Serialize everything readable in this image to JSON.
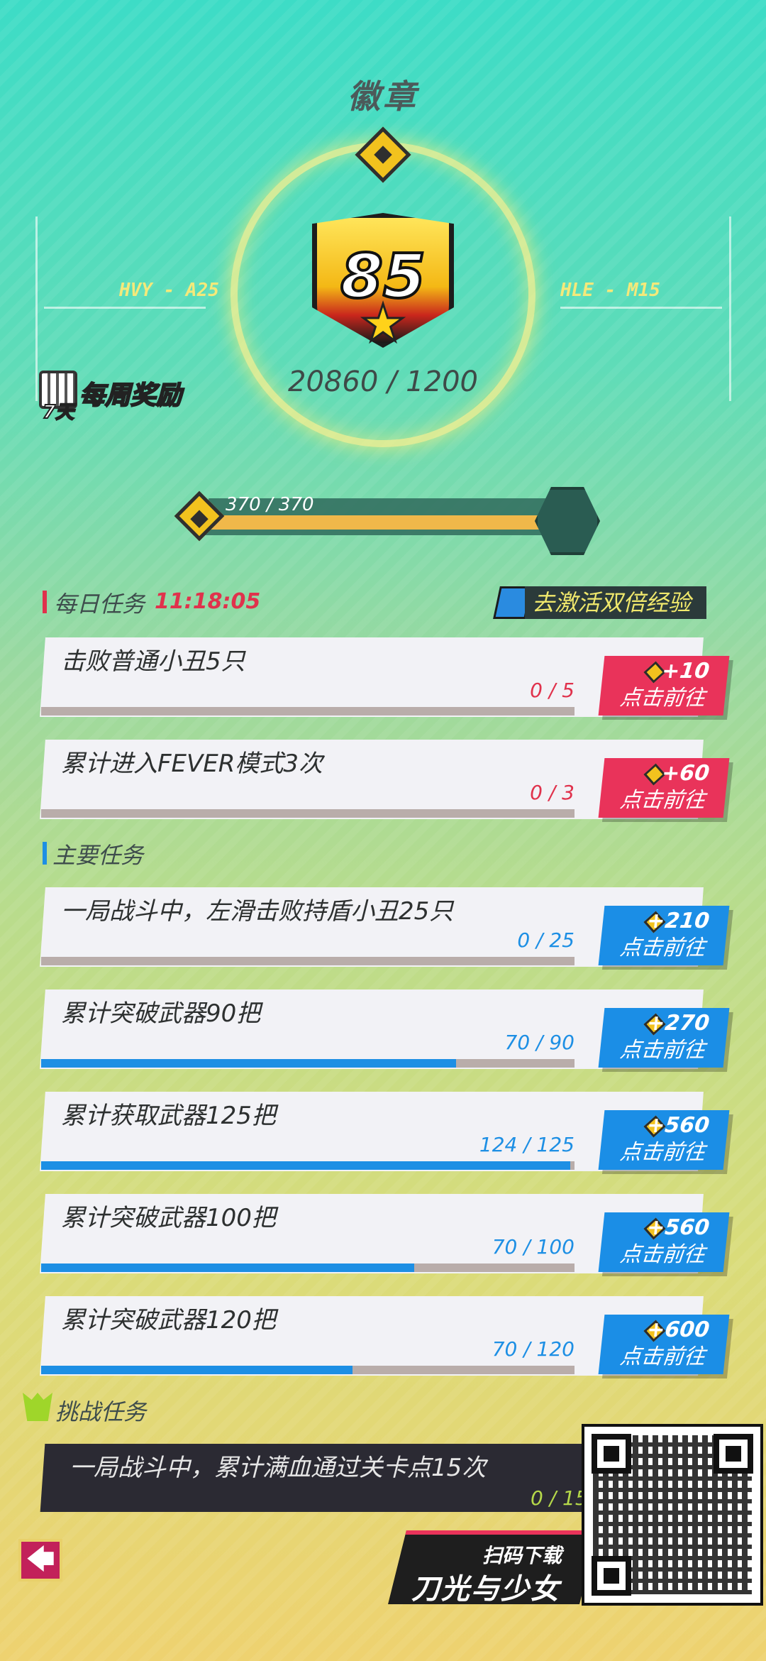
{
  "header": {
    "title": "徽章"
  },
  "badge": {
    "level": "85",
    "points": "20860 / 1200",
    "left_label": "HVY - A25",
    "right_label": "HLE - M15"
  },
  "weekly": {
    "days": "7天",
    "label": "每周奖励"
  },
  "level_progress": {
    "text": "370 / 370",
    "fraction": 1.0
  },
  "daily": {
    "title": "每日任务",
    "timer": "11:18:05",
    "double_exp": "去激活双倍经验",
    "tasks": [
      {
        "title": "击败普通小丑5只",
        "count": "0 / 5",
        "progress": 0,
        "reward": "+10",
        "button": "点击前往"
      },
      {
        "title": "累计进入FEVER模式3次",
        "count": "0 / 3",
        "progress": 0,
        "reward": "+60",
        "button": "点击前往"
      }
    ]
  },
  "main": {
    "title": "主要任务",
    "tasks": [
      {
        "title": "一局战斗中，左滑击败持盾小丑25只",
        "count": "0 / 25",
        "progress": 0,
        "reward": "+210",
        "button": "点击前往"
      },
      {
        "title": "累计突破武器90把",
        "count": "70 / 90",
        "progress": 0.7778,
        "reward": "+270",
        "button": "点击前往"
      },
      {
        "title": "累计获取武器125把",
        "count": "124 / 125",
        "progress": 0.992,
        "reward": "+560",
        "button": "点击前往"
      },
      {
        "title": "累计突破武器100把",
        "count": "70 / 100",
        "progress": 0.7,
        "reward": "+560",
        "button": "点击前往"
      },
      {
        "title": "累计突破武器120把",
        "count": "70 / 120",
        "progress": 0.5833,
        "reward": "+600",
        "button": "点击前往"
      }
    ]
  },
  "challenge": {
    "title": "挑战任务",
    "task": {
      "title": "一局战斗中，累计满血通过关卡点15次",
      "count": "0 / 15"
    }
  },
  "promo": {
    "small": "扫码下载",
    "big": "刀光与少女"
  },
  "back_icon": "arrow-left-icon",
  "colors": {
    "red": "#e9335a",
    "blue": "#1b8ee6",
    "gold": "#f2c21e"
  }
}
